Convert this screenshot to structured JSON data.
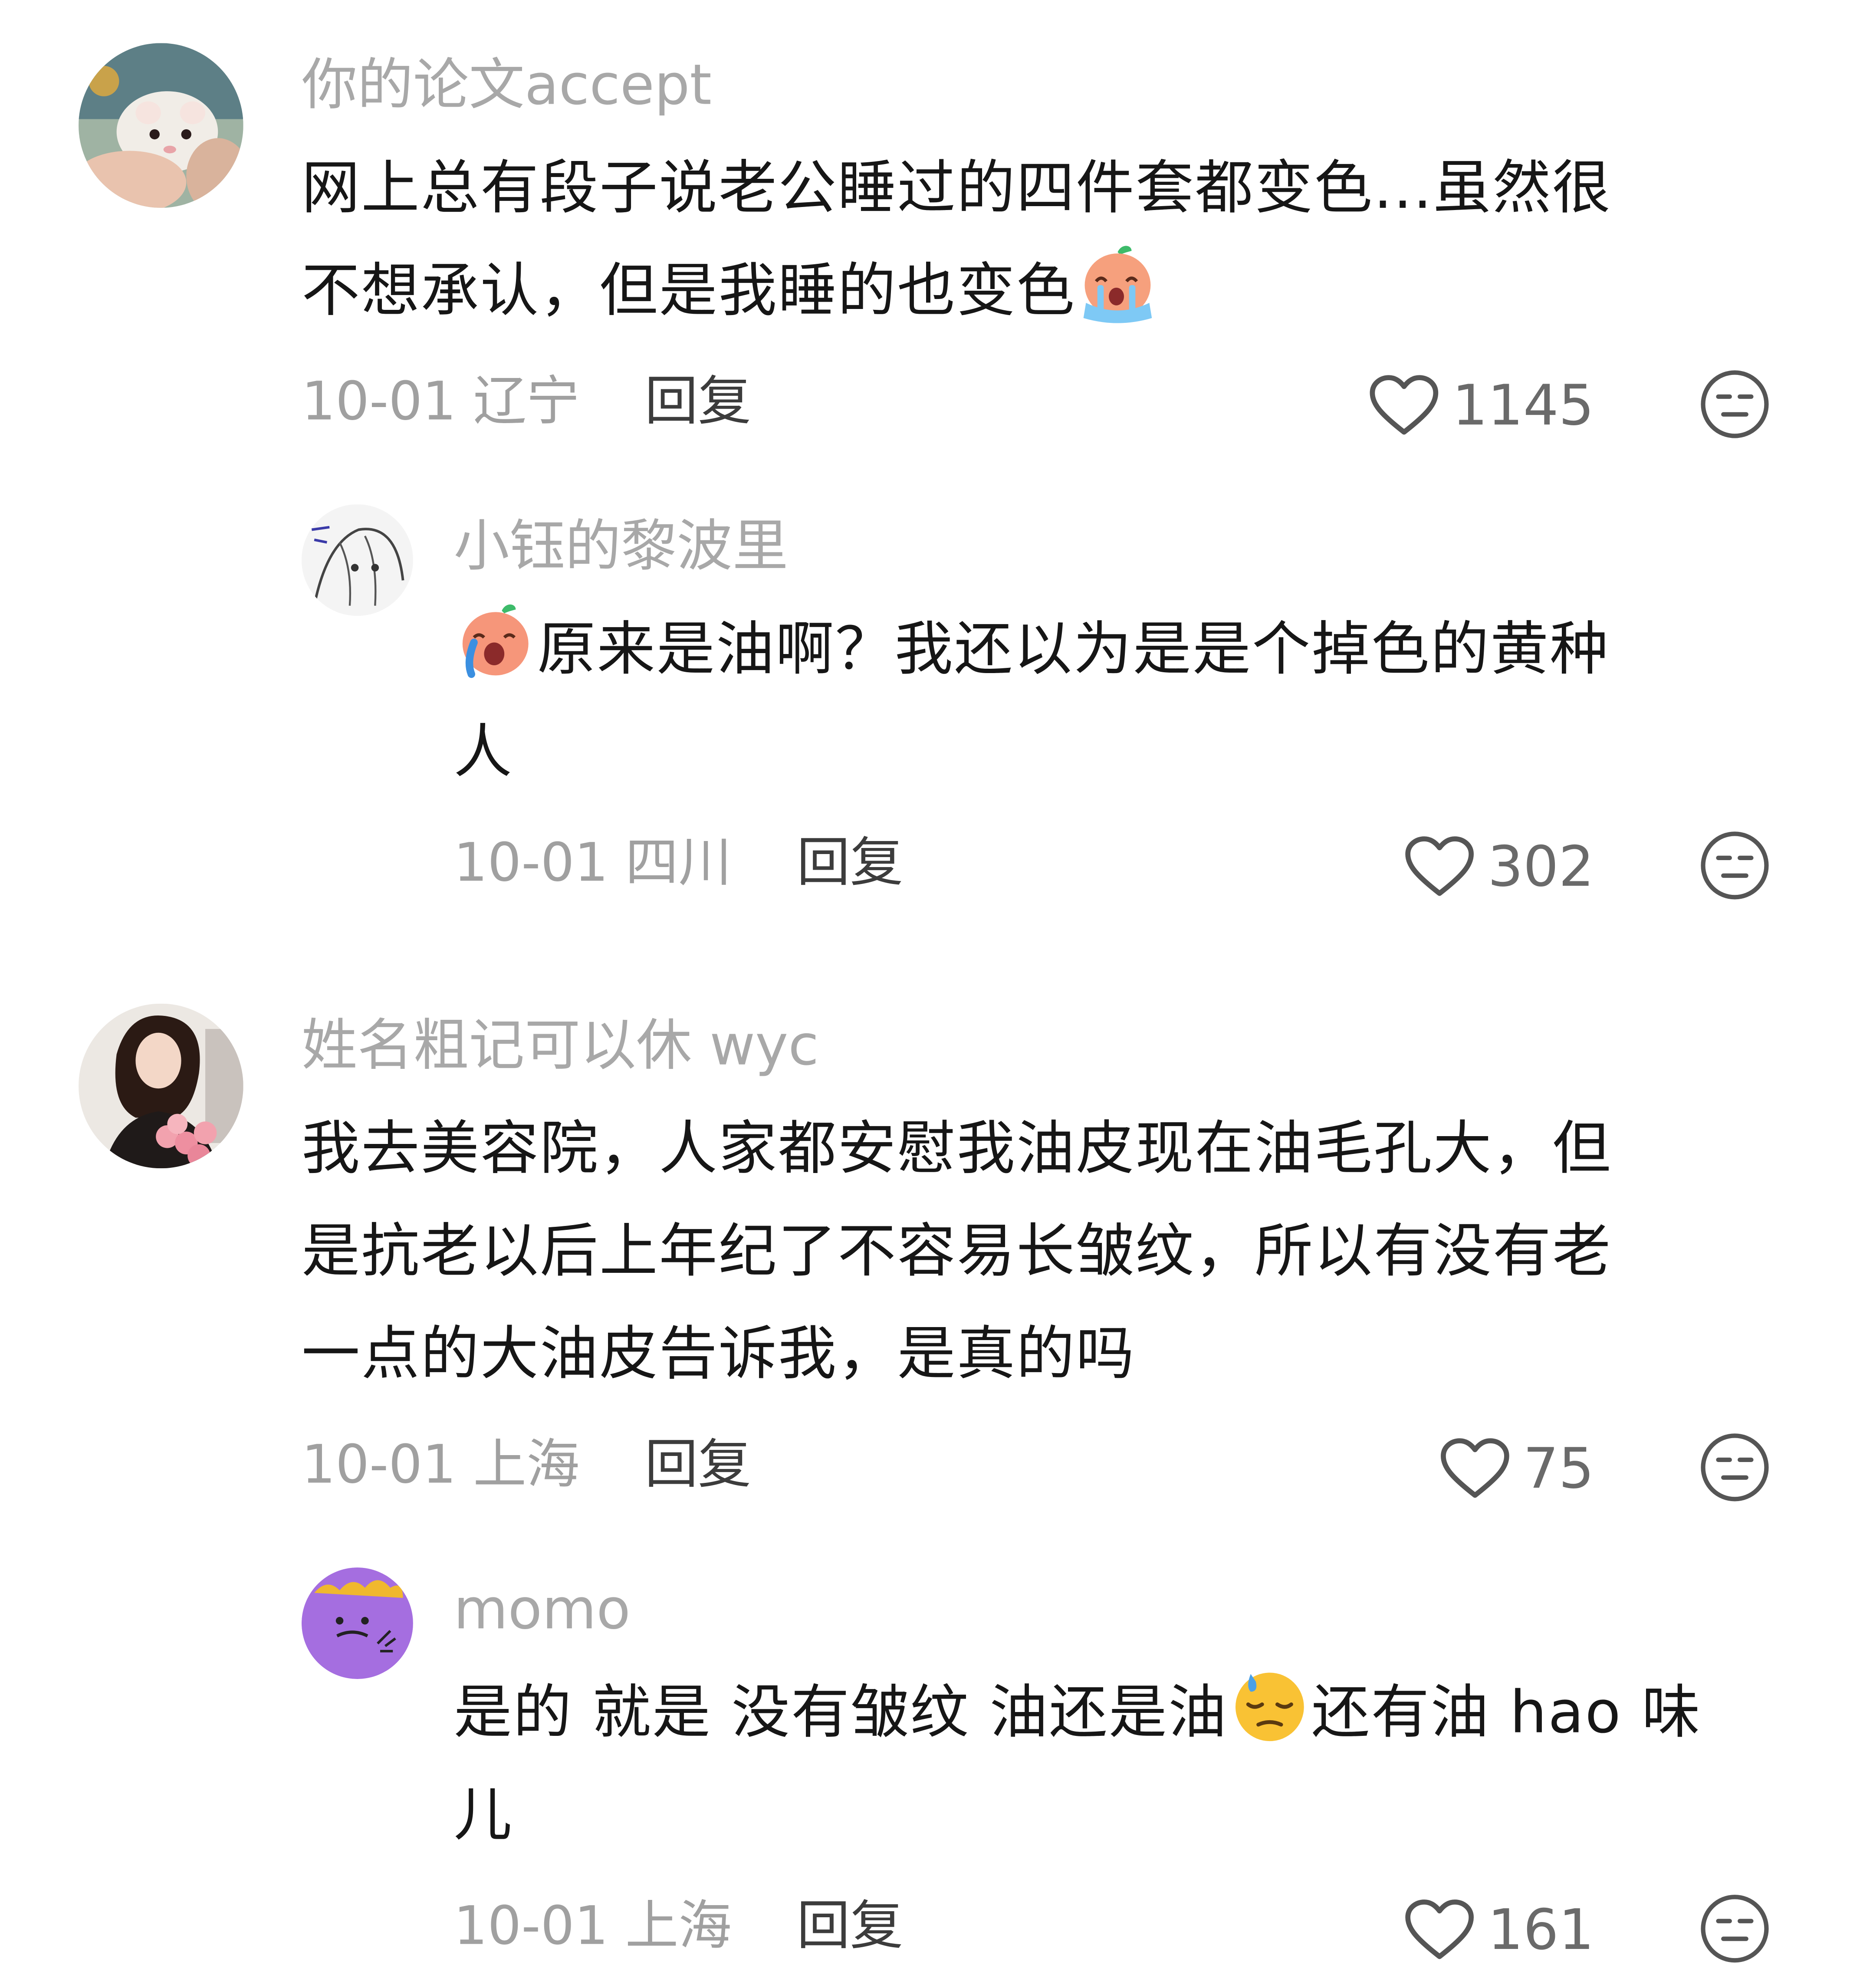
{
  "comments": [
    {
      "username": "你的论文accept",
      "avatar": "hamster-avatar",
      "text_lines": [
        "网上总有段子说老公睡过的四件套都变色...虽然很",
        "不想承认，但是我睡的也变色"
      ],
      "trailing_emoji": "crying-peach-emoji",
      "date": "10-01",
      "location": "辽宁",
      "reply_label": "回复",
      "likes": "1145"
    },
    {
      "username": "小钰的黎波里",
      "avatar": "sketch-portrait-avatar",
      "leading_emoji": "crying-peach-emoji",
      "text_lines": [
        "原来是油啊？我还以为是是个掉色的黄种",
        "人"
      ],
      "date": "10-01",
      "location": "四川",
      "reply_label": "回复",
      "likes": "302"
    },
    {
      "username": "姓名粗记可以休 wyc",
      "avatar": "woman-with-roses-avatar",
      "text_lines": [
        "我去美容院，人家都安慰我油皮现在油毛孔大，但",
        "是抗老以后上年纪了不容易长皱纹，所以有没有老",
        "一点的大油皮告诉我，是真的吗"
      ],
      "date": "10-01",
      "location": "上海",
      "reply_label": "回复",
      "likes": "75"
    },
    {
      "username": "momo",
      "avatar": "purple-monster-avatar",
      "text_before_emoji": "是的 就是 没有皱纹 油还是油",
      "inline_emoji": "downcast-sweat-emoji",
      "text_after_emoji": "还有油 hao 味",
      "text_line2": "儿",
      "date": "10-01",
      "location": "上海",
      "reply_label": "回复",
      "likes": "161"
    }
  ],
  "icons": {
    "like": "heart-outline-icon",
    "dislike": "unamused-face-icon"
  }
}
